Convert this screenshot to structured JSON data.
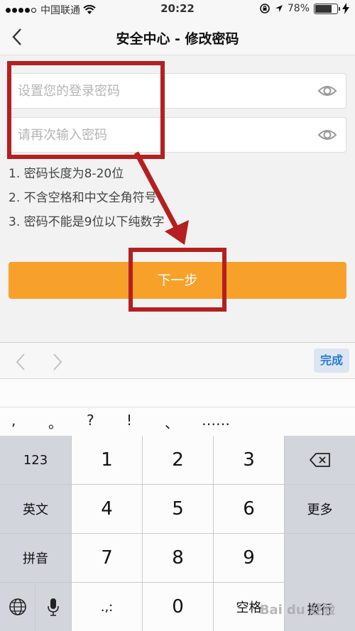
{
  "status_bar": {
    "carrier": "中国联通",
    "time": "20:22",
    "battery": "78%",
    "battery_level": 0.78
  },
  "nav": {
    "back_icon": "chevron-left-icon",
    "title": "安全中心 - 修改密码"
  },
  "form": {
    "password_placeholder": "设置您的登录密码",
    "confirm_placeholder": "请再次输入密码",
    "rules": [
      "1. 密码长度为8-20位",
      "2. 不含空格和中文全角符号",
      "3. 密码不能是9位以下纯数字"
    ],
    "next_label": "下一步"
  },
  "keyboard_toolbar": {
    "done_label": "完成"
  },
  "punctuation": [
    ",",
    "。",
    "?",
    "!",
    "、",
    "……"
  ],
  "keypad": {
    "mode_label": "123",
    "english_label": "英文",
    "pinyin_label": "拼音",
    "more_label": "更多",
    "return_label": "换行",
    "space_label": "空格",
    "punct_label": ".,:",
    "digits": [
      "1",
      "2",
      "3",
      "4",
      "5",
      "6",
      "7",
      "8",
      "9",
      "0"
    ]
  },
  "watermark": "Bai du 经验",
  "colors": {
    "accent": "#f7a12b",
    "annotation": "#b51f1f",
    "done": "#2a7bd5"
  }
}
